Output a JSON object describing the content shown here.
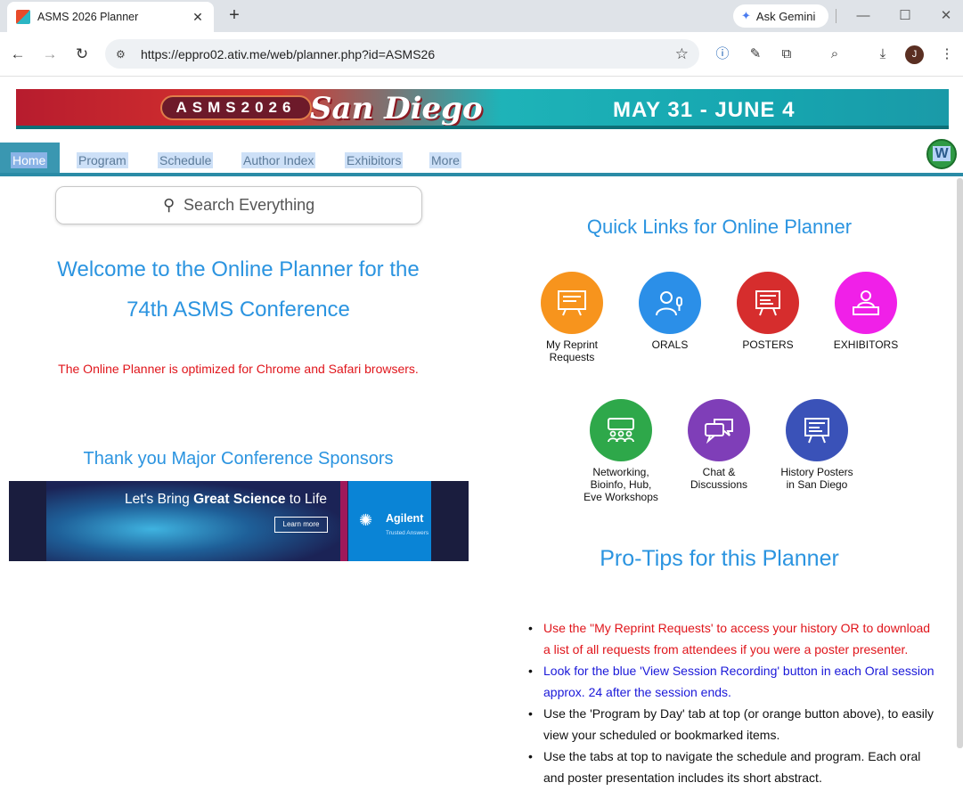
{
  "browser": {
    "tab_title": "ASMS 2026 Planner",
    "tab_close_glyph": "✕",
    "new_tab_glyph": "+",
    "gemini_label": "Ask Gemini",
    "url": "https://eppro02.ativ.me/web/planner.php?id=ASMS26",
    "profile_initial": "J",
    "window_controls": {
      "minimize": "—",
      "maximize": "☐",
      "close": "✕"
    }
  },
  "banner": {
    "event": "ASMS2026",
    "city": "San Diego",
    "dates": "MAY 31 - JUNE 4"
  },
  "nav": {
    "items": [
      "Home",
      "Program",
      "Schedule",
      "Author Index",
      "Exhibitors",
      "More"
    ],
    "user_badge": "W"
  },
  "search": {
    "placeholder": "Search Everything"
  },
  "welcome": {
    "line1": "Welcome to the Online Planner for the",
    "line2": "74th ASMS Conference"
  },
  "optimized_note": "The Online Planner is optimized for Chrome and Safari browsers.",
  "sponsors": {
    "title": "Thank you Major Conference Sponsors",
    "ad": {
      "headline_pre": "Let's Bring ",
      "headline_bold": "Great Science",
      "headline_post": " to Life",
      "cta": "Learn more",
      "brand": "Agilent",
      "tagline": "Trusted Answers"
    }
  },
  "quick_links": {
    "title": "Quick Links for Online Planner",
    "items": [
      {
        "label_1": "My Reprint",
        "label_2": "Requests",
        "color": "#f7941d",
        "icon": "presentation-board-icon"
      },
      {
        "label_1": "ORALS",
        "label_2": "",
        "color": "#2b8fe8",
        "icon": "speaker-microphone-icon"
      },
      {
        "label_1": "POSTERS",
        "label_2": "",
        "color": "#d62d2d",
        "icon": "poster-easel-icon"
      },
      {
        "label_1": "EXHIBITORS",
        "label_2": "",
        "color": "#f020e8",
        "icon": "exhibitor-booth-icon"
      },
      {
        "label_1": "Networking,",
        "label_2": "Bioinfo, Hub,",
        "label_3": "Eve Workshops",
        "color": "#2ea84a",
        "icon": "group-meeting-icon"
      },
      {
        "label_1": "Chat &",
        "label_2": "Discussions",
        "color": "#7f3eb8",
        "icon": "chat-bubbles-icon"
      },
      {
        "label_1": "History Posters",
        "label_2": "in San Diego",
        "color": "#3a52b8",
        "icon": "history-poster-icon"
      }
    ]
  },
  "protips": {
    "title": "Pro-Tips for this Planner",
    "items": [
      {
        "text": "Use the \"My Reprint Requests' to access your history OR to download a list of all requests from attendees if you were a poster presenter.",
        "color": "red"
      },
      {
        "text": "Look for the blue 'View Session Recording' button in each Oral session approx. 24 after the session ends.",
        "color": "blue"
      },
      {
        "text": "Use the 'Program by Day' tab at top (or orange button above), to easily view your scheduled or bookmarked items.",
        "color": "black"
      },
      {
        "text": "Use the tabs at top to navigate the schedule and program. Each oral and poster presentation includes its short abstract.",
        "color": "black"
      }
    ]
  }
}
